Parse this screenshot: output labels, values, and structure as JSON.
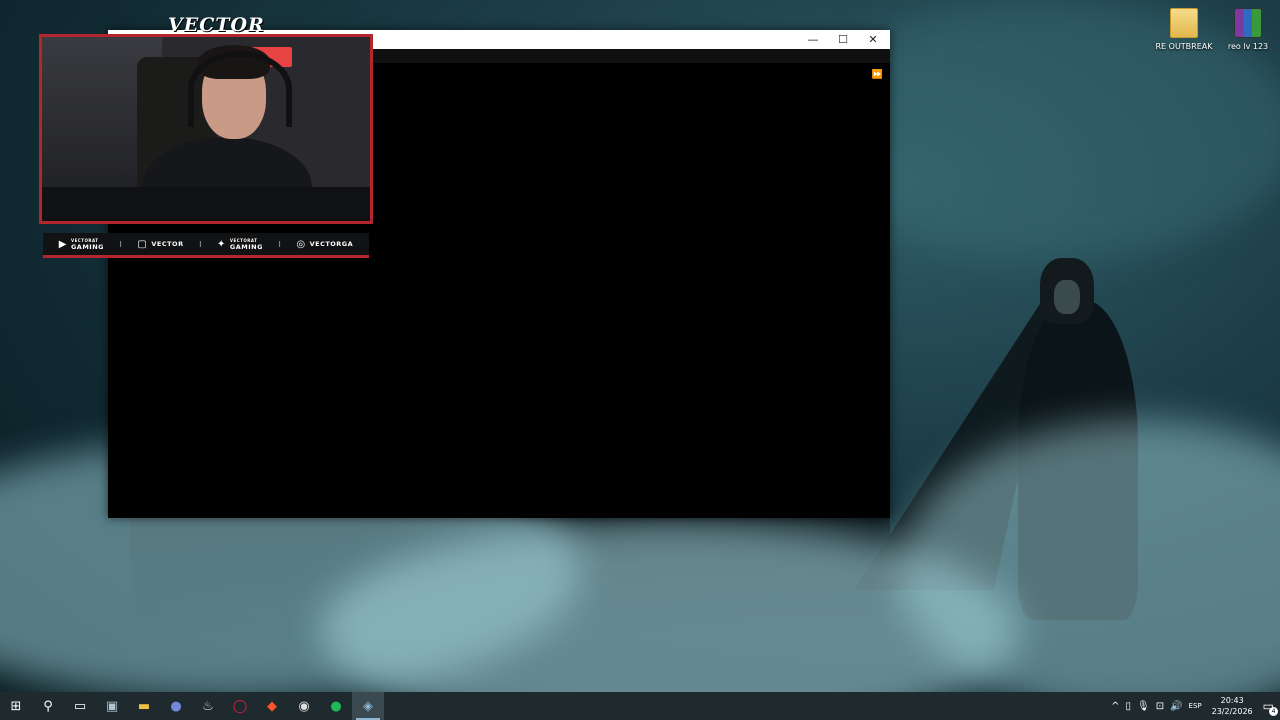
{
  "desktop": {
    "icons": [
      {
        "label": "RE OUTBREAK",
        "icon": "folder-icon"
      },
      {
        "label": "reo lv 123",
        "icon": "winrar-archive-icon"
      }
    ]
  },
  "window": {
    "minimize_glyph": "—",
    "maximize_glyph": "☐",
    "close_glyph": "✕",
    "fast_forward_glyph": "⏩",
    "fill_color": "#000000"
  },
  "overlay": {
    "logo_text": "VECTOR",
    "frame_color": "#b3262e",
    "socials": [
      {
        "icon": "youtube-icon",
        "line1": "VECTORAT",
        "line2": "GAMING"
      },
      {
        "icon": "twitch-icon",
        "line1": "",
        "line2": "VECTOR"
      },
      {
        "icon": "twitter-icon",
        "line1": "VECTORAT",
        "line2": "GAMING"
      },
      {
        "icon": "instagram-icon",
        "line1": "",
        "line2": "VECTORGA"
      }
    ],
    "separator": "I"
  },
  "taskbar": {
    "apps": [
      {
        "name": "start",
        "glyph": "⊞"
      },
      {
        "name": "search",
        "glyph": "⚲"
      },
      {
        "name": "task-view",
        "glyph": "▭"
      },
      {
        "name": "pc-manager",
        "glyph": "▣"
      },
      {
        "name": "file-explorer",
        "glyph": "▬"
      },
      {
        "name": "discord",
        "glyph": "●"
      },
      {
        "name": "steam",
        "glyph": "♨"
      },
      {
        "name": "opera-gx",
        "glyph": "◯"
      },
      {
        "name": "brave",
        "glyph": "◆"
      },
      {
        "name": "obs",
        "glyph": "◉"
      },
      {
        "name": "spotify",
        "glyph": "●"
      },
      {
        "name": "app-active",
        "glyph": "◈"
      }
    ],
    "tray": {
      "chevron": "^",
      "language": "ESP",
      "time": "20:43",
      "date": "23/2/2026",
      "notifications_count": "4"
    }
  }
}
